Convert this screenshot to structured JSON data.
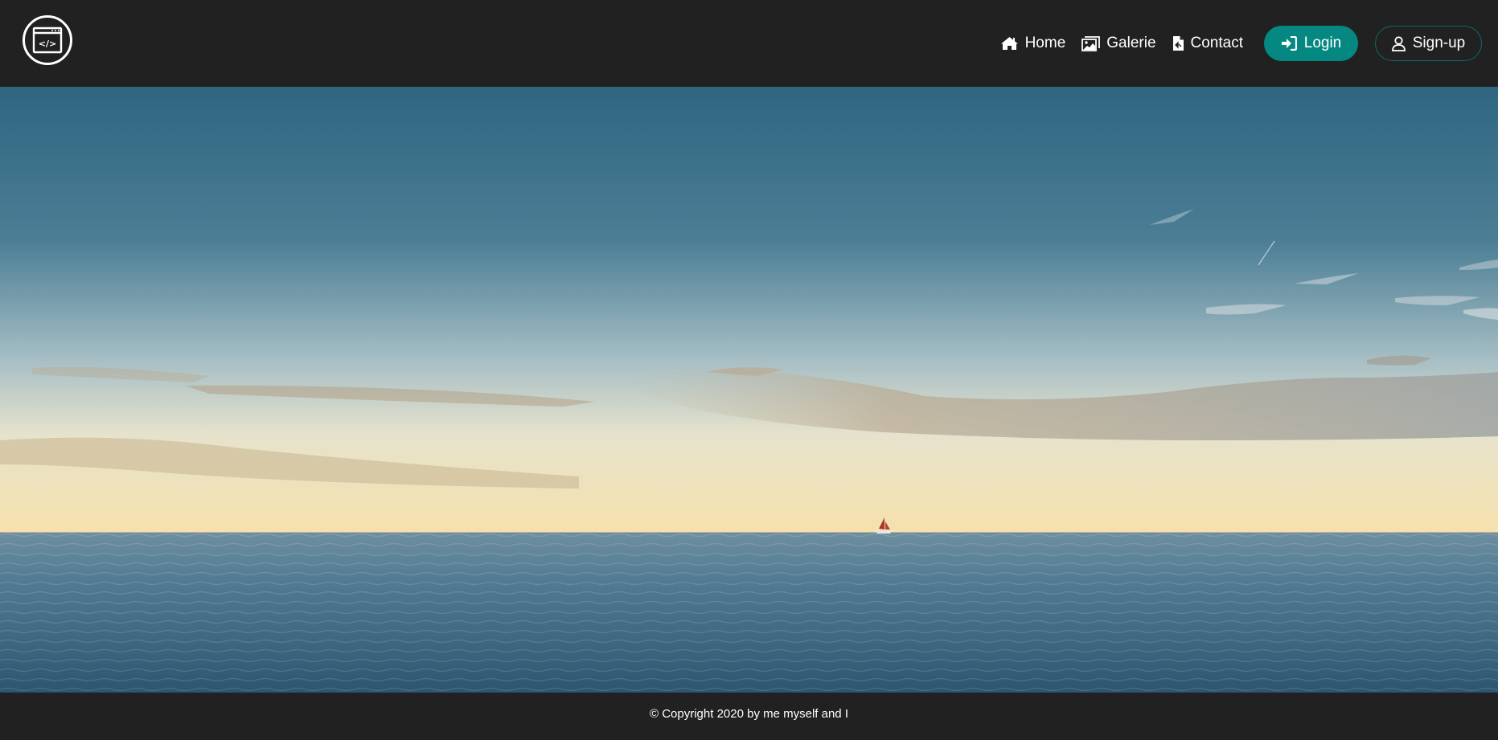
{
  "header": {
    "logo_icon": "code-window-icon",
    "logo_glyph": "</>",
    "nav": {
      "home_label": "Home",
      "home_icon": "home-icon",
      "gallery_label": "Galerie",
      "gallery_icon": "image-icon",
      "contact_label": "Contact",
      "contact_icon": "document-icon"
    },
    "login_label": "Login",
    "login_icon": "sign-in-icon",
    "signup_label": "Sign-up",
    "signup_icon": "user-icon"
  },
  "hero": {
    "image": "sea-horizon-sailboat-image"
  },
  "footer": {
    "copyright": "© Copyright 2020 by me myself and I"
  },
  "colors": {
    "background": "#212121",
    "accent": "#068882",
    "signup_border": "#0c6b68",
    "text": "#ffffff"
  }
}
